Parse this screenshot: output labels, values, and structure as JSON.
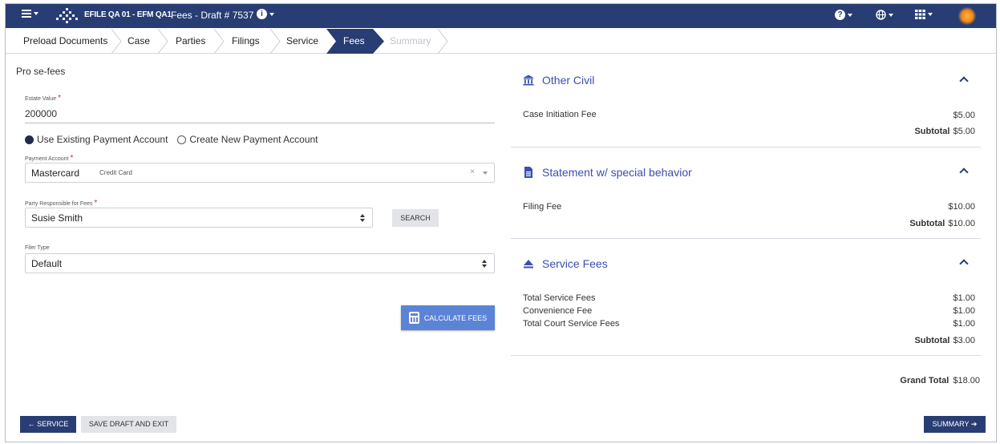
{
  "header": {
    "app_title": "EFILE QA 01 - EFM QA1",
    "page_title": "Fees - Draft # 7537",
    "icons": [
      "menu-icon",
      "logo-icon",
      "info-icon",
      "help-icon",
      "globe-icon",
      "apps-grid-icon",
      "avatar"
    ],
    "bar_color": "#283d73"
  },
  "steps": [
    {
      "label": "Preload Documents",
      "state": "done"
    },
    {
      "label": "Case",
      "state": "done"
    },
    {
      "label": "Parties",
      "state": "done"
    },
    {
      "label": "Filings",
      "state": "done"
    },
    {
      "label": "Service",
      "state": "done"
    },
    {
      "label": "Fees",
      "state": "active"
    },
    {
      "label": "Summary",
      "state": "disabled"
    }
  ],
  "form": {
    "section_title": "Pro se-fees",
    "estate_value_label": "Estate Value",
    "estate_value": "200000",
    "payment_options": [
      "Use Existing Payment Account",
      "Create New Payment Account"
    ],
    "payment_selected": "Use Existing Payment Account",
    "payment_account_label": "Payment Account",
    "payment_account_value": "Mastercard",
    "payment_account_type": "Credit Card",
    "clear_symbol": "×",
    "party_label": "Party Responsible for Fees",
    "party_value": "Susie Smith",
    "search_label": "SEARCH",
    "filer_type_label": "Filer Type",
    "filer_type_value": "Default",
    "calculate_label": "CALCULATE FEES"
  },
  "fees": {
    "groups": [
      {
        "title": "Other Civil",
        "icon": "bank-icon",
        "lines": [
          {
            "name": "Case Initiation Fee",
            "amount": "$5.00"
          }
        ],
        "subtotal_label": "Subtotal",
        "subtotal": "$5.00"
      },
      {
        "title": "Statement w/ special behavior",
        "icon": "document-icon",
        "lines": [
          {
            "name": "Filing Fee",
            "amount": "$10.00"
          }
        ],
        "subtotal_label": "Subtotal",
        "subtotal": "$10.00"
      },
      {
        "title": "Service Fees",
        "icon": "eject-icon",
        "lines": [
          {
            "name": "Total Service Fees",
            "amount": "$1.00"
          },
          {
            "name": "Convenience Fee",
            "amount": "$1.00"
          },
          {
            "name": "Total Court Service Fees",
            "amount": "$1.00"
          }
        ],
        "subtotal_label": "Subtotal",
        "subtotal": "$3.00"
      }
    ],
    "grand_total_label": "Grand Total",
    "grand_total": "$18.00",
    "accent_color": "#3a4fb0"
  },
  "footer": {
    "back_label": "← SERVICE",
    "save_label": "SAVE DRAFT AND EXIT",
    "next_label": "SUMMARY ➔"
  }
}
